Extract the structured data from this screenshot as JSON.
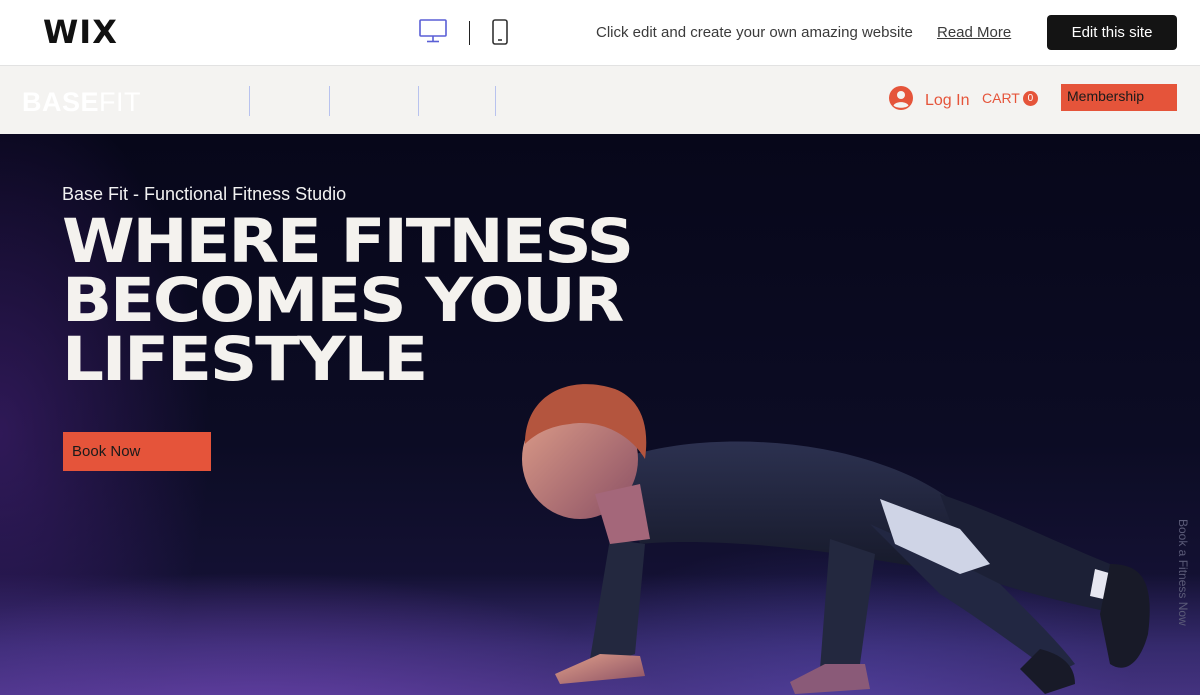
{
  "wix_bar": {
    "logo": "WIX",
    "devices": [
      "desktop-icon",
      "mobile-icon"
    ],
    "tagline": "Click edit and create your own amazing website",
    "read_more": "Read More",
    "edit_button": "Edit this site"
  },
  "site_header": {
    "brand_bold": "BASE",
    "brand_light": "FIT",
    "login_label": "Log In",
    "cart_label": "CART",
    "cart_count": "0",
    "membership_button": "Membership"
  },
  "hero": {
    "subtitle": "Base Fit - Functional Fitness Studio",
    "title_lines": [
      "WHERE FITNESS",
      "BECOMES YOUR",
      "LIFESTYLE"
    ],
    "book_button": "Book Now",
    "side_text": "Book a Fitness Now"
  },
  "colors": {
    "accent": "#e5543a",
    "wix_bar_bg": "#ffffff",
    "site_header_bg": "#f4f3f1",
    "hero_bg": "#0c0c24",
    "edit_button_bg": "#141414"
  }
}
